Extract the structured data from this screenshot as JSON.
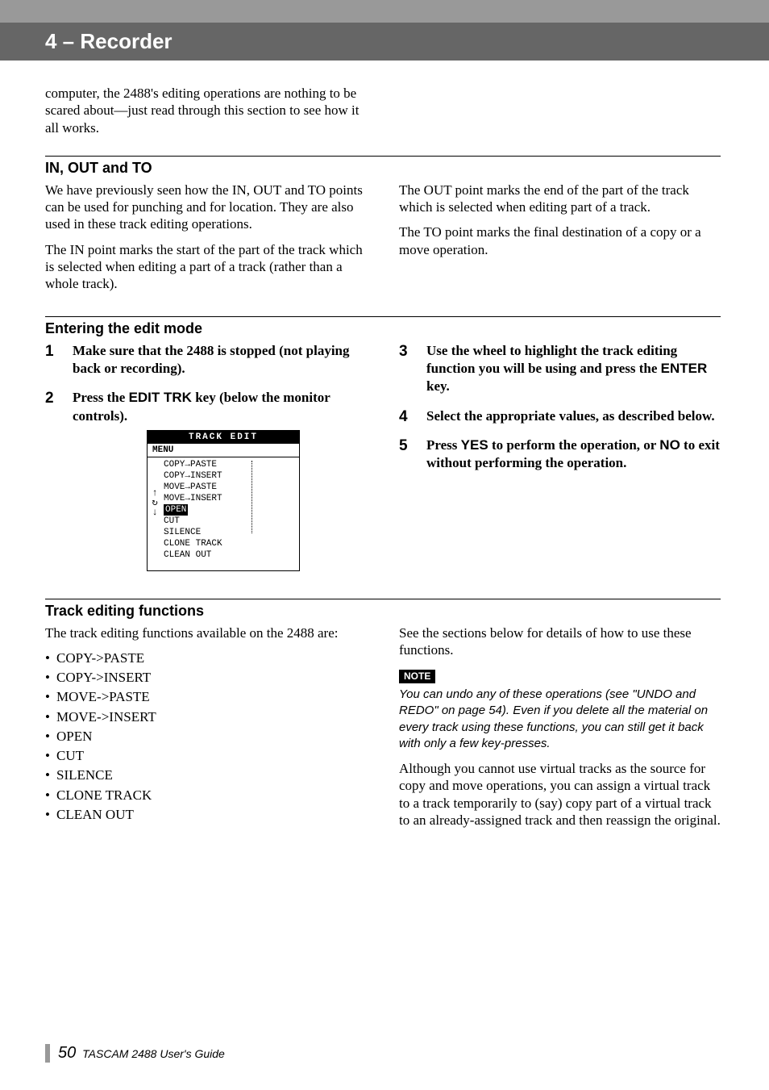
{
  "header": {
    "section_title": "4 – Recorder"
  },
  "intro": {
    "p1": "computer, the 2488's editing operations are nothing to be scared about—just read through this section to see how it all works."
  },
  "inout": {
    "heading": "IN, OUT and TO",
    "left_p1": "We have previously seen how the IN, OUT and TO points can be used for punching and for location. They are also used in these track editing operations.",
    "left_p2": "The IN point marks the start of the part of the track which is selected when editing a part of a track (rather than a whole track).",
    "right_p1": "The OUT point marks the end of the part of the track which is selected when editing part of a track.",
    "right_p2": "The TO point marks the final destination of a copy or a move operation."
  },
  "editmode": {
    "heading": "Entering the edit mode",
    "step1": "Make sure that the 2488 is stopped (not playing back or recording).",
    "step2_before": "Press the ",
    "step2_key": "EDIT TRK",
    "step2_after": " key (below the monitor controls).",
    "step3_before": "Use the wheel to highlight the track editing function you will be using and press the ",
    "step3_key": "ENTER",
    "step3_after": " key.",
    "step4": "Select the appropriate values, as described below.",
    "step5_before": "Press ",
    "step5_key1": "YES",
    "step5_mid": " to perform the operation, or ",
    "step5_key2": "NO",
    "step5_after": " to exit without performing the operation."
  },
  "lcd": {
    "title": "TRACK EDIT",
    "menu_label": "MENU",
    "items": {
      "i0": "COPY→PASTE",
      "i1": "COPY→INSERT",
      "i2": "MOVE→PASTE",
      "i3": "MOVE→INSERT",
      "i4": "OPEN",
      "i5": "CUT",
      "i6": "SILENCE",
      "i7": "CLONE TRACK",
      "i8": "CLEAN OUT"
    }
  },
  "trackfn": {
    "heading": "Track editing functions",
    "left_intro": "The track editing functions available on the 2488 are:",
    "bullets": {
      "b0": "COPY->PASTE",
      "b1": "COPY->INSERT",
      "b2": "MOVE->PASTE",
      "b3": "MOVE->INSERT",
      "b4": "OPEN",
      "b5": "CUT",
      "b6": "SILENCE",
      "b7": "CLONE TRACK",
      "b8": "CLEAN OUT"
    },
    "right_intro": "See the sections below for details of how to use these functions.",
    "note_label": "NOTE",
    "note_text": "You can undo any of these operations (see \"UNDO and REDO\" on page 54). Even if you delete all the material on every track using these functions, you can still get it back with only a few key-presses.",
    "right_p2": "Although you cannot use virtual tracks as the source for copy and move operations, you can assign a virtual track to a track temporarily to (say) copy part of a virtual track to an already-assigned track and then reassign the original."
  },
  "footer": {
    "page_number": "50",
    "guide_text": " TASCAM 2488 User's Guide"
  }
}
